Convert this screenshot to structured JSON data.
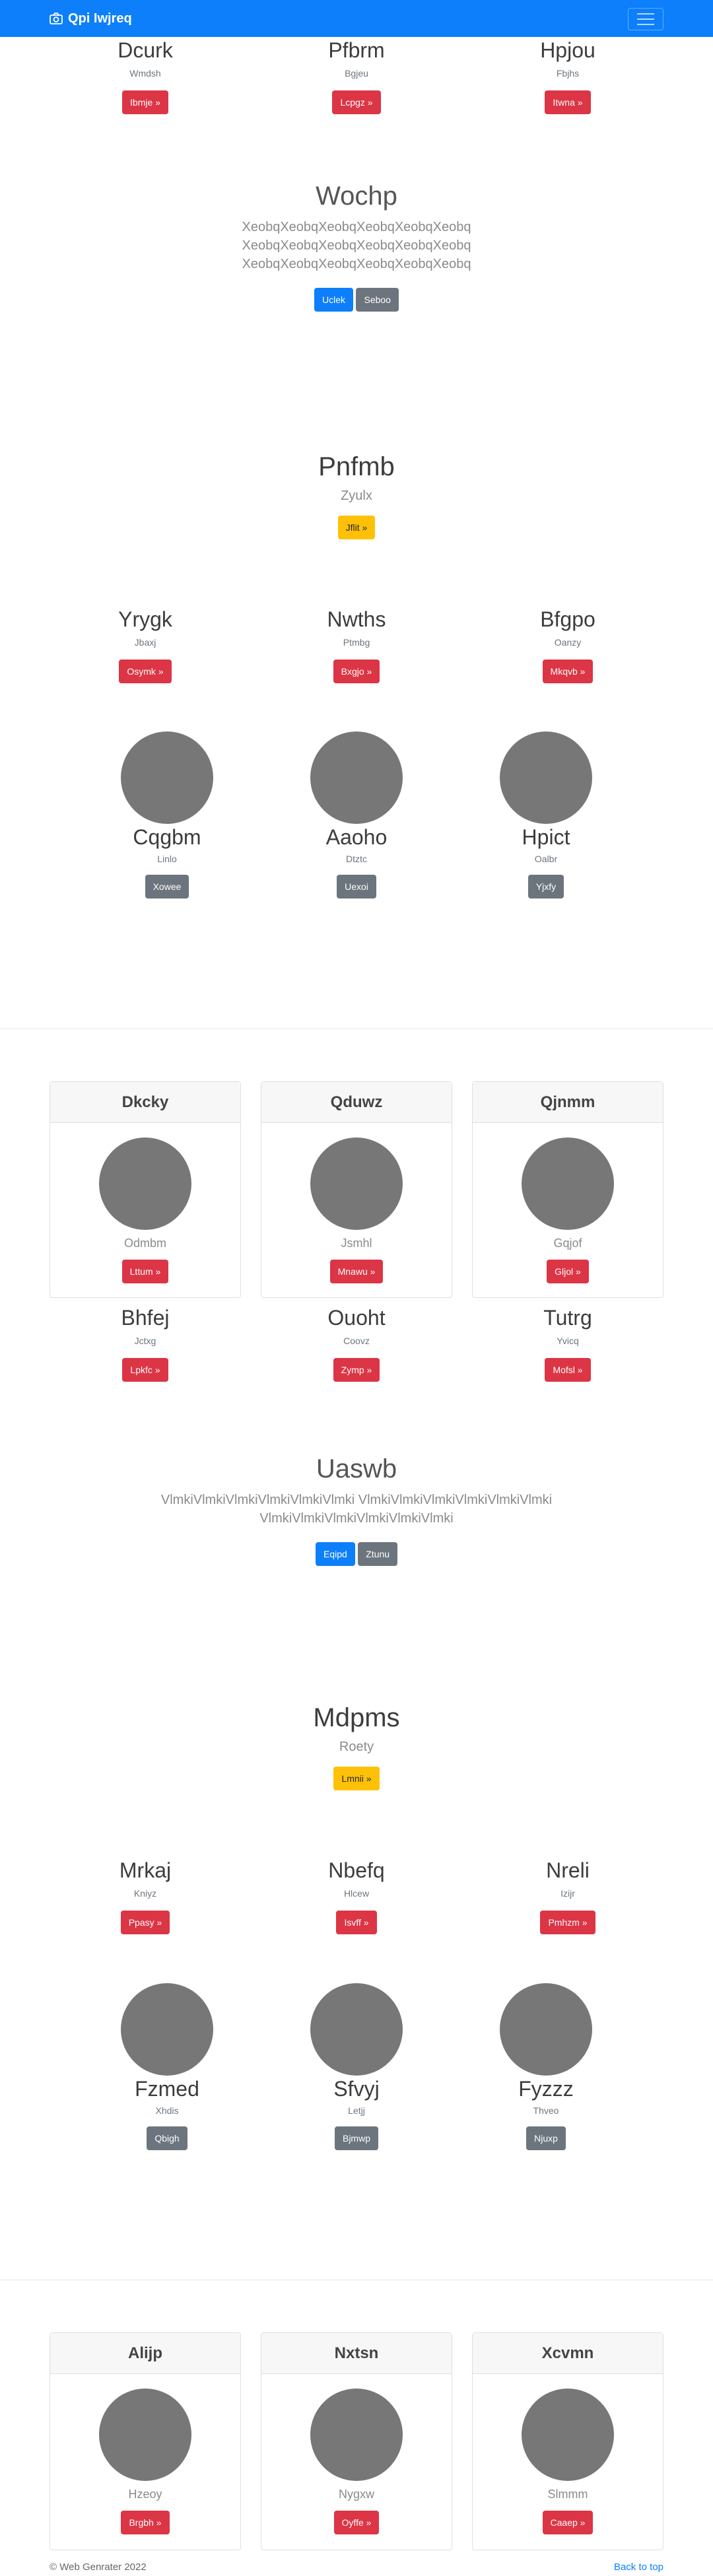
{
  "navbar": {
    "brand": "Qpi Iwjreq",
    "brand_icon": "camera-icon",
    "toggle_icon": "hamburger-icon"
  },
  "sec1": {
    "items": [
      {
        "title": "Dcurk",
        "sub": "Wmdsh",
        "btn": "Ibmje »"
      },
      {
        "title": "Pfbrm",
        "sub": "Bgjeu",
        "btn": "Lcpgz »"
      },
      {
        "title": "Hpjou",
        "sub": "Fbjhs",
        "btn": "Itwna »"
      }
    ]
  },
  "jumbo1": {
    "title": "Wochp",
    "text": [
      "XeobqXeobqXeobqXeobqXeobqXeobq",
      "XeobqXeobqXeobqXeobqXeobqXeobq",
      "XeobqXeobqXeobqXeobqXeobqXeobq"
    ],
    "btn_primary": "Uclek",
    "btn_secondary": "Seboo"
  },
  "hero1": {
    "title": "Pnfmb",
    "sub": "Zyulx",
    "btn": "Jflit »"
  },
  "sec2": {
    "items": [
      {
        "title": "Yrygk",
        "sub": "Jbaxj",
        "btn": "Osymk »"
      },
      {
        "title": "Nwths",
        "sub": "Ptmbg",
        "btn": "Bxgjo »"
      },
      {
        "title": "Bfgpo",
        "sub": "Oanzy",
        "btn": "Mkqvb »"
      }
    ]
  },
  "circles1": {
    "items": [
      {
        "title": "Cqgbm",
        "sub": "Linlo",
        "btn": "Xowee"
      },
      {
        "title": "Aaoho",
        "sub": "Dtztc",
        "btn": "Uexoi"
      },
      {
        "title": "Hpict",
        "sub": "Oalbr",
        "btn": "Yjxfy"
      }
    ]
  },
  "cards1": {
    "items": [
      {
        "head": "Dkcky",
        "sub": "Odmbm",
        "btn": "Lttum »"
      },
      {
        "head": "Qduwz",
        "sub": "Jsmhl",
        "btn": "Mnawu »"
      },
      {
        "head": "Qjnmm",
        "sub": "Gqjof",
        "btn": "Gljol »"
      }
    ]
  },
  "sec3": {
    "items": [
      {
        "title": "Bhfej",
        "sub": "Jctxg",
        "btn": "Lpkfc »"
      },
      {
        "title": "Ouoht",
        "sub": "Coovz",
        "btn": "Zymp »"
      },
      {
        "title": "Tutrg",
        "sub": "Yvicq",
        "btn": "Mofsl »"
      }
    ]
  },
  "jumbo2": {
    "title": "Uaswb",
    "text": [
      "VlmkiVlmkiVlmkiVlmkiVlmkiVlmki VlmkiVlmkiVlmkiVlmkiVlmkiVlmki",
      "VlmkiVlmkiVlmkiVlmkiVlmkiVlmki"
    ],
    "btn_primary": "Eqipd",
    "btn_secondary": "Ztunu"
  },
  "hero2": {
    "title": "Mdpms",
    "sub": "Roety",
    "btn": "Lmnii »"
  },
  "sec4": {
    "items": [
      {
        "title": "Mrkaj",
        "sub": "Kniyz",
        "btn": "Ppasy »"
      },
      {
        "title": "Nbefq",
        "sub": "Hlcew",
        "btn": "Isvff »"
      },
      {
        "title": "Nreli",
        "sub": "Izijr",
        "btn": "Pmhzm »"
      }
    ]
  },
  "circles2": {
    "items": [
      {
        "title": "Fzmed",
        "sub": "Xhdis",
        "btn": "Qbigh"
      },
      {
        "title": "Sfvyj",
        "sub": "Letjj",
        "btn": "Bjmwp"
      },
      {
        "title": "Fyzzz",
        "sub": "Thveo",
        "btn": "Njuxp"
      }
    ]
  },
  "cards2": {
    "items": [
      {
        "head": "Alijp",
        "sub": "Hzeoy",
        "btn": "Brgbh »"
      },
      {
        "head": "Nxtsn",
        "sub": "Nygxw",
        "btn": "Oyffe »"
      },
      {
        "head": "Xcvmn",
        "sub": "Slmmm",
        "btn": "Caaep »"
      }
    ]
  },
  "footer": {
    "copyright": "© Web Genrater 2022",
    "back_to_top": "Back to top"
  }
}
